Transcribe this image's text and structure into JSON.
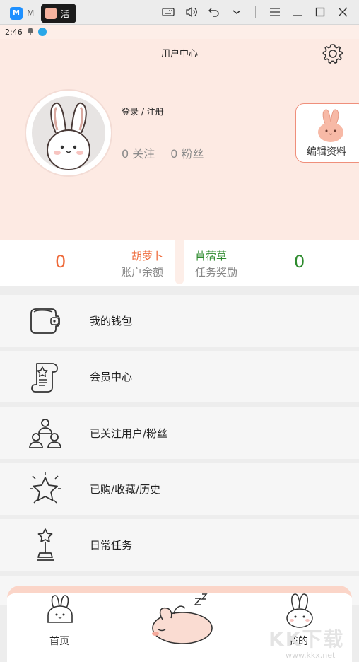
{
  "emulator": {
    "tab1_label": "M",
    "tab2_label": "活",
    "accent_blue": "#1e90ff"
  },
  "status_bar": {
    "time": "2:46"
  },
  "header": {
    "title": "用户中心",
    "login_label": "登录 / 注册",
    "follow_text": "0 关注",
    "fans_text": "0 粉丝",
    "edit_label": "编辑资料"
  },
  "balance": {
    "left_value": "0",
    "left_name": "胡萝卜",
    "left_sub": "账户余额",
    "left_color": "#ee6a3a",
    "right_name": "苜蓿草",
    "right_sub": "任务奖励",
    "right_value": "0",
    "right_color": "#2e8b2e"
  },
  "menu": {
    "items": [
      {
        "label": "我的钱包",
        "icon": "wallet-icon"
      },
      {
        "label": "会员中心",
        "icon": "scroll-star-icon"
      },
      {
        "label": "已关注用户/粉丝",
        "icon": "users-icon"
      },
      {
        "label": "已购/收藏/历史",
        "icon": "star-burst-icon"
      },
      {
        "label": "日常任务",
        "icon": "trophy-icon"
      }
    ]
  },
  "bottom_nav": {
    "home_label": "首页",
    "mine_label": "我的"
  },
  "watermark": {
    "text": "KK下载",
    "url": "www.kkx.net"
  }
}
